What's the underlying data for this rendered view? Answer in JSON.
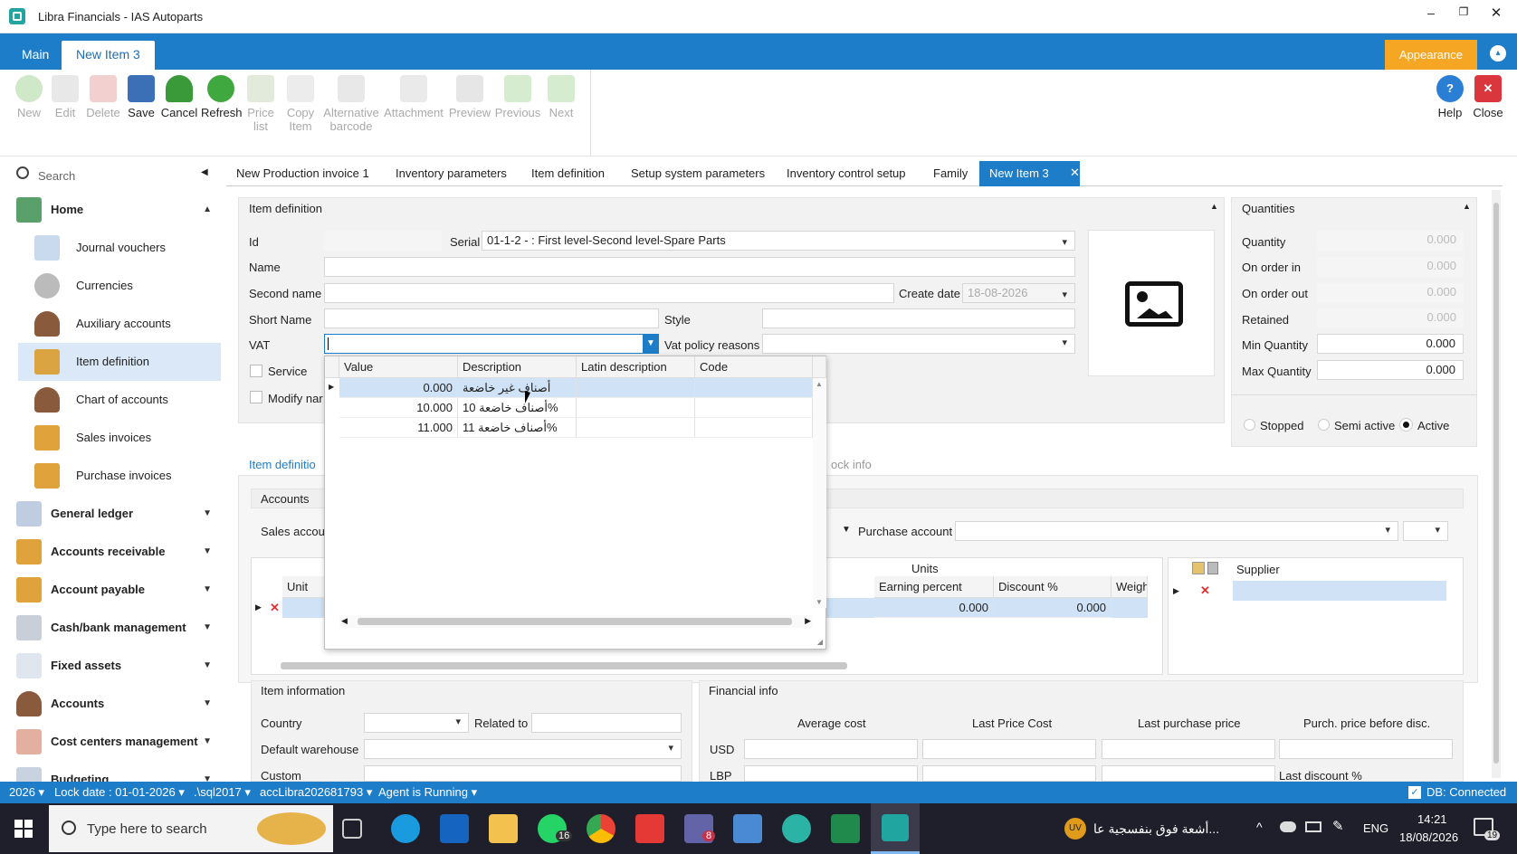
{
  "window": {
    "title": "Libra Financials - IAS Autoparts",
    "controls": [
      "minimize",
      "restore",
      "close"
    ]
  },
  "ribbon_tabs": [
    {
      "label": "Main"
    },
    {
      "label": "New Item 3"
    }
  ],
  "appearance_label": "Appearance",
  "toolbar": [
    {
      "label": "New",
      "icon": "add-icon",
      "enabled": false
    },
    {
      "label": "Edit",
      "icon": "edit-icon",
      "enabled": false
    },
    {
      "label": "Delete",
      "icon": "delete-icon",
      "enabled": false
    },
    {
      "label": "Save",
      "icon": "save-icon",
      "enabled": true
    },
    {
      "label": "Cancel",
      "icon": "cancel-icon",
      "enabled": true
    },
    {
      "label": "Refresh",
      "icon": "refresh-icon",
      "enabled": true
    },
    {
      "label": "Price list",
      "icon": "price-list-icon",
      "enabled": false
    },
    {
      "label": "Copy Item",
      "icon": "copy-icon",
      "enabled": false
    },
    {
      "label": "Alternative barcode",
      "icon": "barcode-icon",
      "enabled": false
    },
    {
      "label": "Attachment",
      "icon": "attachment-icon",
      "enabled": false
    },
    {
      "label": "Preview",
      "icon": "print-preview-icon",
      "enabled": false
    },
    {
      "label": "Previous",
      "icon": "arrow-up-icon",
      "enabled": false
    },
    {
      "label": "Next",
      "icon": "arrow-down-icon",
      "enabled": false
    }
  ],
  "toolbar_right": [
    {
      "label": "Help",
      "icon": "help-icon"
    },
    {
      "label": "Close",
      "icon": "close-icon"
    }
  ],
  "sidebar": {
    "search_placeholder": "Search",
    "home_label": "Home",
    "home_items": [
      {
        "label": "Journal vouchers",
        "icon": "journal-icon"
      },
      {
        "label": "Currencies",
        "icon": "gear-icon"
      },
      {
        "label": "Auxiliary accounts",
        "icon": "user-icon"
      },
      {
        "label": "Item definition",
        "icon": "boxes-icon",
        "selected": true
      },
      {
        "label": "Chart of accounts",
        "icon": "user-icon"
      },
      {
        "label": "Sales invoices",
        "icon": "box-in-icon"
      },
      {
        "label": "Purchase invoices",
        "icon": "box-out-icon"
      }
    ],
    "groups": [
      {
        "label": "General ledger",
        "icon": "ledger-icon"
      },
      {
        "label": "Accounts receivable",
        "icon": "box-in-icon"
      },
      {
        "label": "Account payable",
        "icon": "box-out-icon"
      },
      {
        "label": "Cash/bank management",
        "icon": "calculator-icon"
      },
      {
        "label": "Fixed assets",
        "icon": "document-icon"
      },
      {
        "label": "Accounts",
        "icon": "user-icon"
      },
      {
        "label": "Cost centers management",
        "icon": "grid-icon"
      },
      {
        "label": "Budgeting",
        "icon": "chart-icon"
      }
    ]
  },
  "doc_tabs": [
    {
      "label": "New Production invoice 1"
    },
    {
      "label": "Inventory parameters"
    },
    {
      "label": "Item definition"
    },
    {
      "label": "Setup system parameters"
    },
    {
      "label": "Inventory control setup"
    },
    {
      "label": "Family"
    },
    {
      "label": "New Item 3",
      "active": true
    }
  ],
  "item_definition": {
    "section_title": "Item definition",
    "id_label": "Id",
    "id_value": "",
    "serial_label": "Serial",
    "serial_value": "01-1-2 -      : First level-Second level-Spare Parts",
    "name_label": "Name",
    "second_name_label": "Second name",
    "create_date_label": "Create date",
    "create_date_value": "18-08-2026",
    "short_name_label": "Short Name",
    "style_label": "Style",
    "vat_label": "VAT",
    "vat_value": "",
    "vat_policy_label": "Vat policy reasons",
    "service_label": "Service",
    "modify_name_label": "Modify nar"
  },
  "quantities": {
    "title": "Quantities",
    "rows": [
      {
        "label": "Quantity",
        "value": "0.000",
        "enabled": false
      },
      {
        "label": "On order in",
        "value": "0.000",
        "enabled": false
      },
      {
        "label": "On order out",
        "value": "0.000",
        "enabled": false
      },
      {
        "label": "Retained",
        "value": "0.000",
        "enabled": false
      },
      {
        "label": "Min Quantity",
        "value": "0.000",
        "enabled": true
      },
      {
        "label": "Max Quantity",
        "value": "0.000",
        "enabled": true
      }
    ],
    "status": [
      {
        "label": "Stopped",
        "checked": false
      },
      {
        "label": "Semi active",
        "checked": false
      },
      {
        "label": "Active",
        "checked": true
      }
    ]
  },
  "vat_popup": {
    "columns": [
      "Value",
      "Description",
      "Latin description",
      "Code"
    ],
    "rows": [
      {
        "value": "0.000",
        "description": "أصناف غير خاضعة",
        "latin": "",
        "code": ""
      },
      {
        "value": "10.000",
        "description": "أصناف خاضعة 10%",
        "latin": "",
        "code": ""
      },
      {
        "value": "11.000",
        "description": "أصناف خاضعة 11%",
        "latin": "",
        "code": ""
      }
    ]
  },
  "lower": {
    "subtab_item_def": "Item definitio",
    "subtab_stock_info": "ock info",
    "accounts_title": "Accounts",
    "sales_account_label": "Sales accou",
    "purchase_account_label": "Purchase account",
    "units_title": "Units",
    "units_columns": [
      "Unit",
      "Earning percent",
      "Discount %",
      "Weigh"
    ],
    "units_row": {
      "earning": "0.000",
      "discount": "0.000"
    },
    "supplier_title": "Supplier",
    "item_information_title": "Item information",
    "country_label": "Country",
    "related_to_label": "Related to",
    "default_warehouse_label": "Default warehouse",
    "custom_label": "Custom",
    "financial_info_title": "Financial info",
    "fin_columns": [
      "Average cost",
      "Last Price Cost",
      "Last purchase price",
      "Purch. price before disc."
    ],
    "fin_rows": [
      "USD",
      "LBP"
    ],
    "last_discount_label": "Last discount %"
  },
  "statusbar": {
    "year": "2026",
    "lock_date": "Lock date : 01-01-2026",
    "server": ".\\sql2017",
    "database": "accLibra202681793",
    "agent": "Agent is Running",
    "db_status": "DB: Connected"
  },
  "taskbar": {
    "search_placeholder": "Type here to search",
    "news_text": "أشعة فوق بنفسجية عا...",
    "news_badge": "UV",
    "language": "ENG",
    "time": "14:21",
    "date": "18/08/2026",
    "notification_count": "19",
    "whatsapp_badge": "16",
    "teams_badge": "8"
  }
}
